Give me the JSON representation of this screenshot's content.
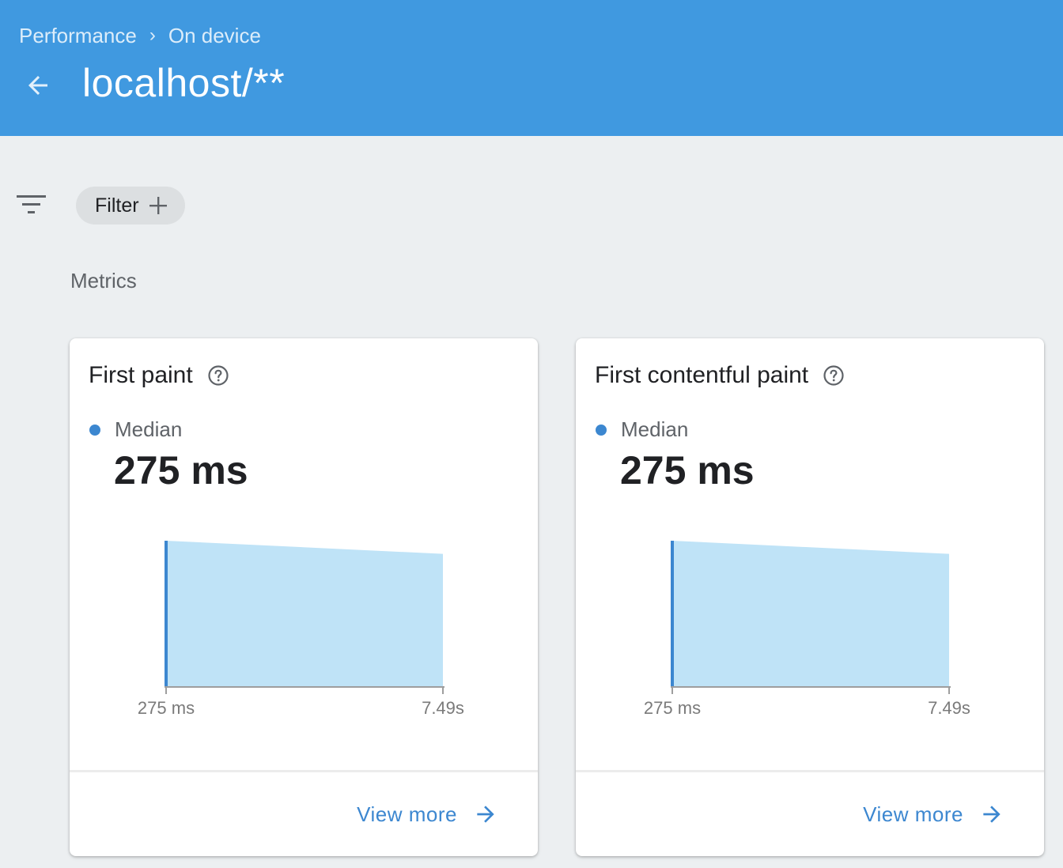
{
  "header": {
    "breadcrumb": [
      "Performance",
      "On device"
    ],
    "breadcrumb_separator": "›",
    "title": "localhost/**",
    "background_color": "#4099e0"
  },
  "toolbar": {
    "filter_label": "Filter",
    "filter_add_symbol": "+"
  },
  "section": {
    "label": "Metrics"
  },
  "cards": [
    {
      "title": "First paint",
      "legend_label": "Median",
      "median_value": "275 ms",
      "view_more_label": "View more"
    },
    {
      "title": "First contentful paint",
      "legend_label": "Median",
      "median_value": "275 ms",
      "view_more_label": "View more"
    }
  ],
  "chart_data": [
    {
      "type": "area",
      "x_tick_labels": [
        "275 ms",
        "7.49s"
      ],
      "relative_heights": [
        1.0,
        0.91
      ],
      "median_marker": "275 ms",
      "fill_color": "#bfe3f7",
      "marker_color": "#3c87d0",
      "grid": false
    },
    {
      "type": "area",
      "x_tick_labels": [
        "275 ms",
        "7.49s"
      ],
      "relative_heights": [
        1.0,
        0.91
      ],
      "median_marker": "275 ms",
      "fill_color": "#bfe3f7",
      "marker_color": "#3c87d0",
      "grid": false
    }
  ],
  "colors": {
    "accent": "#3c87d0",
    "page_background": "#eceff1"
  }
}
